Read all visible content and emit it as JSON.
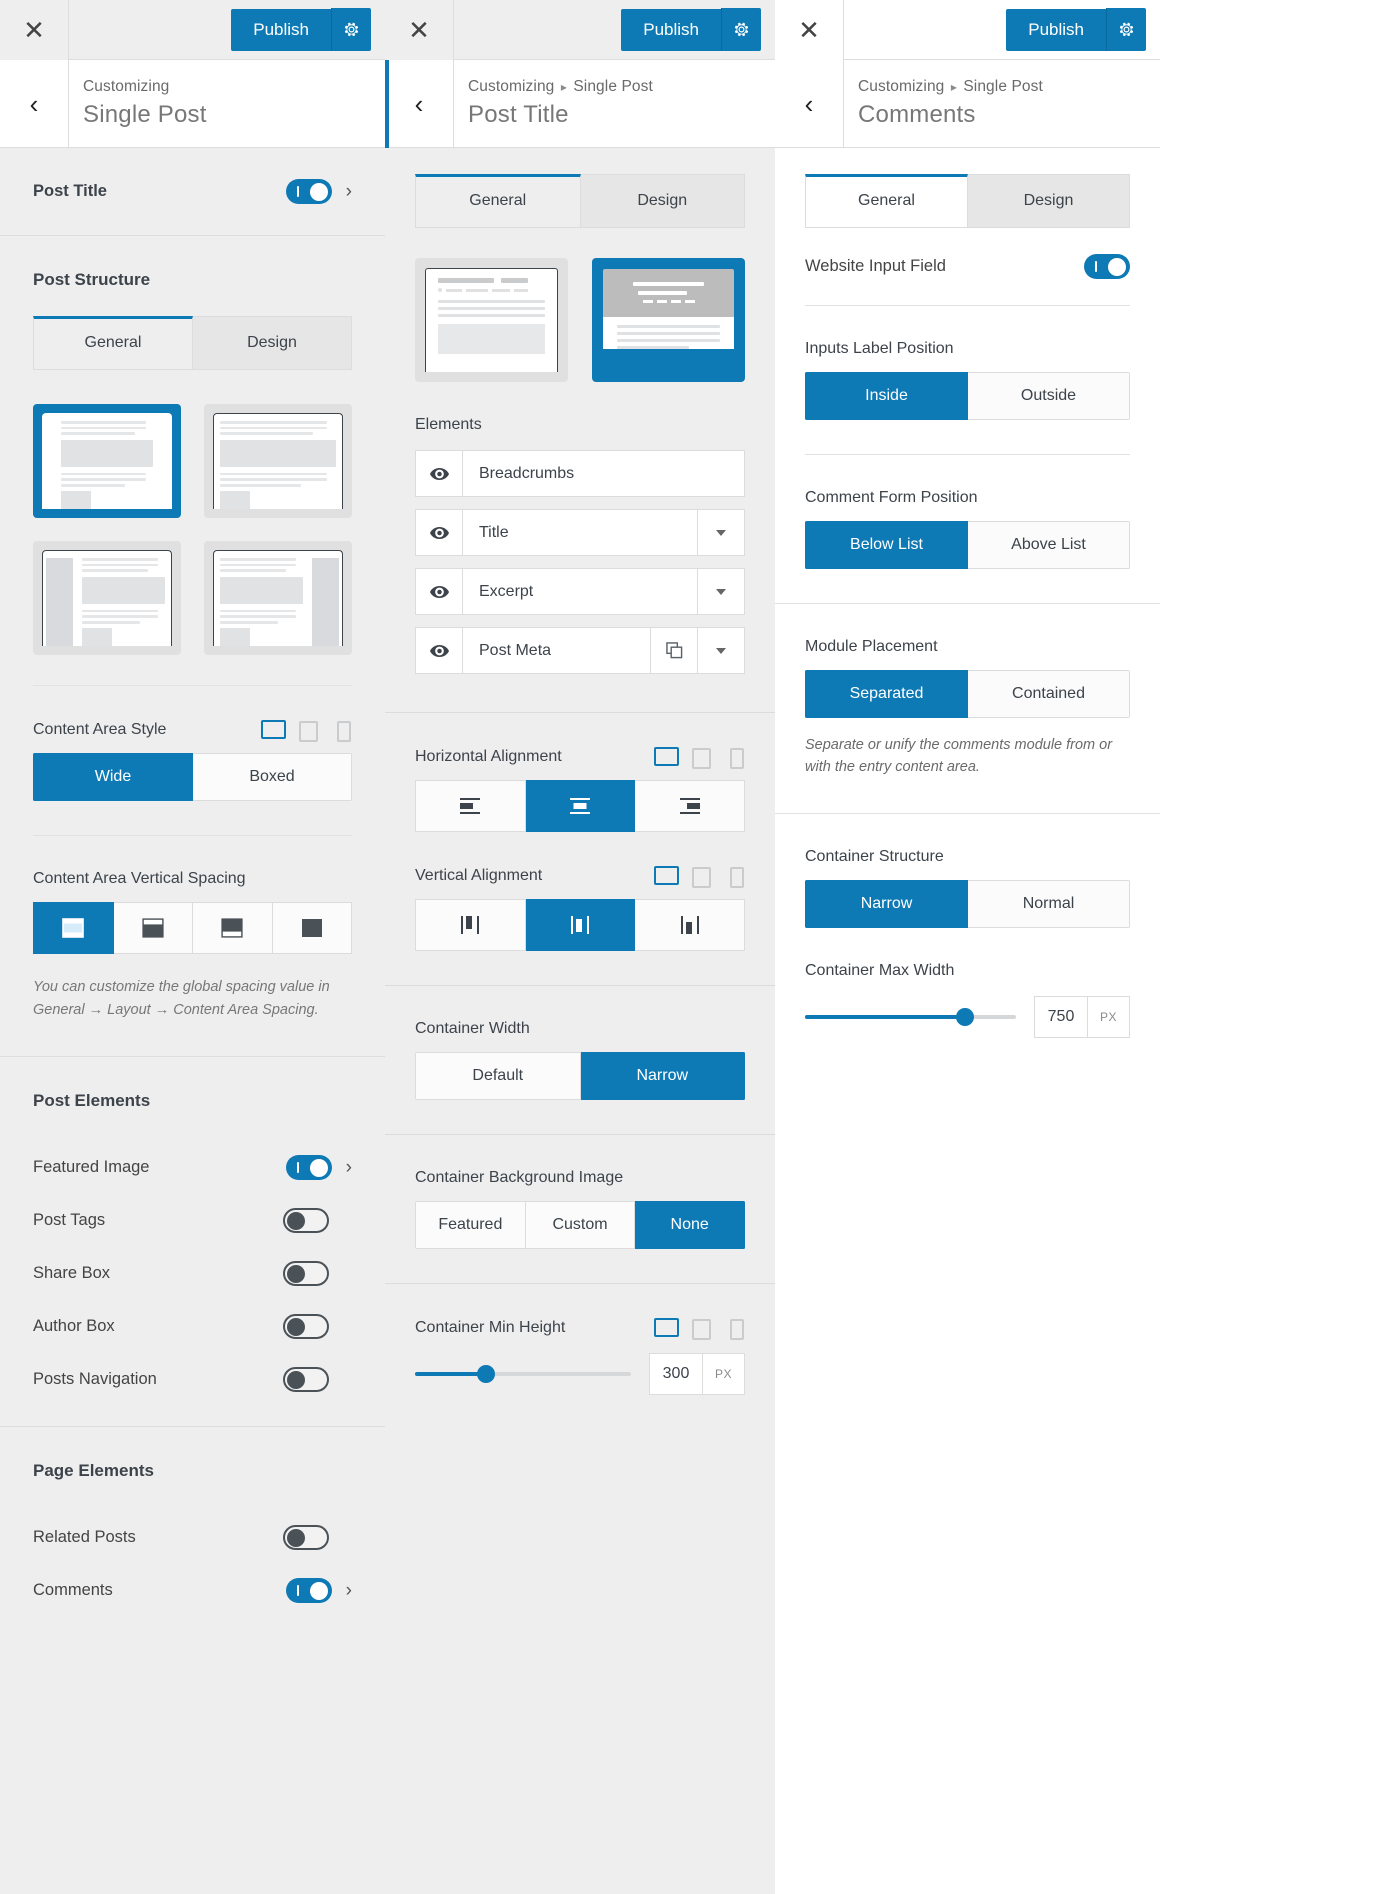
{
  "panels": [
    {
      "topbar": {
        "close_icon": "close-icon",
        "publish_label": "Publish",
        "gear_icon": "gear-icon"
      },
      "header": {
        "back_icon": "chevron-left-icon",
        "crumb": "Customizing",
        "title": "Single Post"
      },
      "post_title_row": {
        "label": "Post Title",
        "toggle_state": "on",
        "chevron": "chevron-right-icon"
      },
      "post_structure": {
        "title": "Post Structure",
        "tabs": [
          {
            "label": "General",
            "active": true
          },
          {
            "label": "Design",
            "active": false
          }
        ],
        "layouts": [
          {
            "name": "full-width-no-sidebar",
            "selected": true
          },
          {
            "name": "contained-no-sidebar",
            "selected": false
          },
          {
            "name": "left-sidebar",
            "selected": false
          },
          {
            "name": "right-sidebar",
            "selected": false
          }
        ],
        "content_area_style": {
          "label": "Content Area Style",
          "devices": [
            "desktop",
            "tablet",
            "mobile"
          ],
          "active_device": "desktop",
          "options": [
            {
              "label": "Wide",
              "selected": true
            },
            {
              "label": "Boxed",
              "selected": false
            }
          ]
        },
        "vertical_spacing": {
          "label": "Content Area Vertical Spacing",
          "options": [
            {
              "name": "spacing-both",
              "selected": true
            },
            {
              "name": "spacing-top",
              "selected": false
            },
            {
              "name": "spacing-bottom",
              "selected": false
            },
            {
              "name": "spacing-none",
              "selected": false
            }
          ],
          "note": "You can customize the global spacing value in General → Layout → Content Area Spacing."
        }
      },
      "post_elements": {
        "title": "Post Elements",
        "items": [
          {
            "label": "Featured Image",
            "toggle_state": "on",
            "has_chevron": true
          },
          {
            "label": "Post Tags",
            "toggle_state": "off",
            "has_chevron": false
          },
          {
            "label": "Share Box",
            "toggle_state": "off",
            "has_chevron": false
          },
          {
            "label": "Author Box",
            "toggle_state": "off",
            "has_chevron": false
          },
          {
            "label": "Posts Navigation",
            "toggle_state": "off",
            "has_chevron": false
          }
        ]
      },
      "page_elements": {
        "title": "Page Elements",
        "items": [
          {
            "label": "Related Posts",
            "toggle_state": "off",
            "has_chevron": false
          },
          {
            "label": "Comments",
            "toggle_state": "on",
            "has_chevron": true
          }
        ]
      }
    },
    {
      "topbar": {
        "close_icon": "close-icon",
        "publish_label": "Publish",
        "gear_icon": "gear-icon"
      },
      "header": {
        "back_icon": "chevron-left-icon",
        "crumb_root": "Customizing",
        "crumb_sep": "▸",
        "crumb_child": "Single Post",
        "title": "Post Title"
      },
      "tabs": [
        {
          "label": "General",
          "active": true
        },
        {
          "label": "Design",
          "active": false
        }
      ],
      "previews": [
        {
          "name": "plain-title-preview",
          "selected": false
        },
        {
          "name": "banner-title-preview",
          "selected": true
        }
      ],
      "elements": {
        "label": "Elements",
        "items": [
          {
            "label": "Breadcrumbs",
            "eye_icon": "eye-icon",
            "has_caret": false,
            "has_copy": false
          },
          {
            "label": "Title",
            "eye_icon": "eye-icon",
            "has_caret": true,
            "has_copy": false
          },
          {
            "label": "Excerpt",
            "eye_icon": "eye-icon",
            "has_caret": true,
            "has_copy": false
          },
          {
            "label": "Post Meta",
            "eye_icon": "eye-icon",
            "has_caret": true,
            "has_copy": true
          }
        ]
      },
      "horizontal_alignment": {
        "label": "Horizontal Alignment",
        "devices": [
          "desktop",
          "tablet",
          "mobile"
        ],
        "active_device": "desktop",
        "options": [
          {
            "name": "align-left",
            "selected": false
          },
          {
            "name": "align-center",
            "selected": true
          },
          {
            "name": "align-right",
            "selected": false
          }
        ]
      },
      "vertical_alignment": {
        "label": "Vertical Alignment",
        "devices": [
          "desktop",
          "tablet",
          "mobile"
        ],
        "active_device": "desktop",
        "options": [
          {
            "name": "valign-top",
            "selected": false
          },
          {
            "name": "valign-middle",
            "selected": true
          },
          {
            "name": "valign-bottom",
            "selected": false
          }
        ]
      },
      "container_width": {
        "label": "Container Width",
        "options": [
          {
            "label": "Default",
            "selected": false
          },
          {
            "label": "Narrow",
            "selected": true
          }
        ]
      },
      "container_bg_image": {
        "label": "Container Background Image",
        "options": [
          {
            "label": "Featured",
            "selected": false
          },
          {
            "label": "Custom",
            "selected": false
          },
          {
            "label": "None",
            "selected": true
          }
        ]
      },
      "container_min_height": {
        "label": "Container Min Height",
        "devices": [
          "desktop",
          "tablet",
          "mobile"
        ],
        "active_device": "desktop",
        "value": "300",
        "unit": "PX",
        "fill_percent": 33
      }
    },
    {
      "topbar": {
        "close_icon": "close-icon",
        "publish_label": "Publish",
        "gear_icon": "gear-icon"
      },
      "header": {
        "back_icon": "chevron-left-icon",
        "crumb_root": "Customizing",
        "crumb_sep": "▸",
        "crumb_child": "Single Post",
        "title": "Comments"
      },
      "tabs": [
        {
          "label": "General",
          "active": true
        },
        {
          "label": "Design",
          "active": false
        }
      ],
      "website_input_field": {
        "label": "Website Input Field",
        "toggle_state": "on"
      },
      "inputs_label_position": {
        "label": "Inputs Label Position",
        "options": [
          {
            "label": "Inside",
            "selected": true
          },
          {
            "label": "Outside",
            "selected": false
          }
        ]
      },
      "comment_form_position": {
        "label": "Comment Form Position",
        "options": [
          {
            "label": "Below List",
            "selected": true
          },
          {
            "label": "Above List",
            "selected": false
          }
        ]
      },
      "module_placement": {
        "label": "Module Placement",
        "options": [
          {
            "label": "Separated",
            "selected": true
          },
          {
            "label": "Contained",
            "selected": false
          }
        ],
        "note": "Separate or unify the comments module from or with the entry content area."
      },
      "container_structure": {
        "label": "Container Structure",
        "options": [
          {
            "label": "Narrow",
            "selected": true
          },
          {
            "label": "Normal",
            "selected": false
          }
        ]
      },
      "container_max_width": {
        "label": "Container Max Width",
        "value": "750",
        "unit": "PX",
        "fill_percent": 76
      }
    }
  ],
  "colors": {
    "accent": "#0e7ab5",
    "panel_bg": "#eeeeee",
    "text": "#3c434a",
    "muted": "#777777",
    "border": "#dcdcdc"
  }
}
